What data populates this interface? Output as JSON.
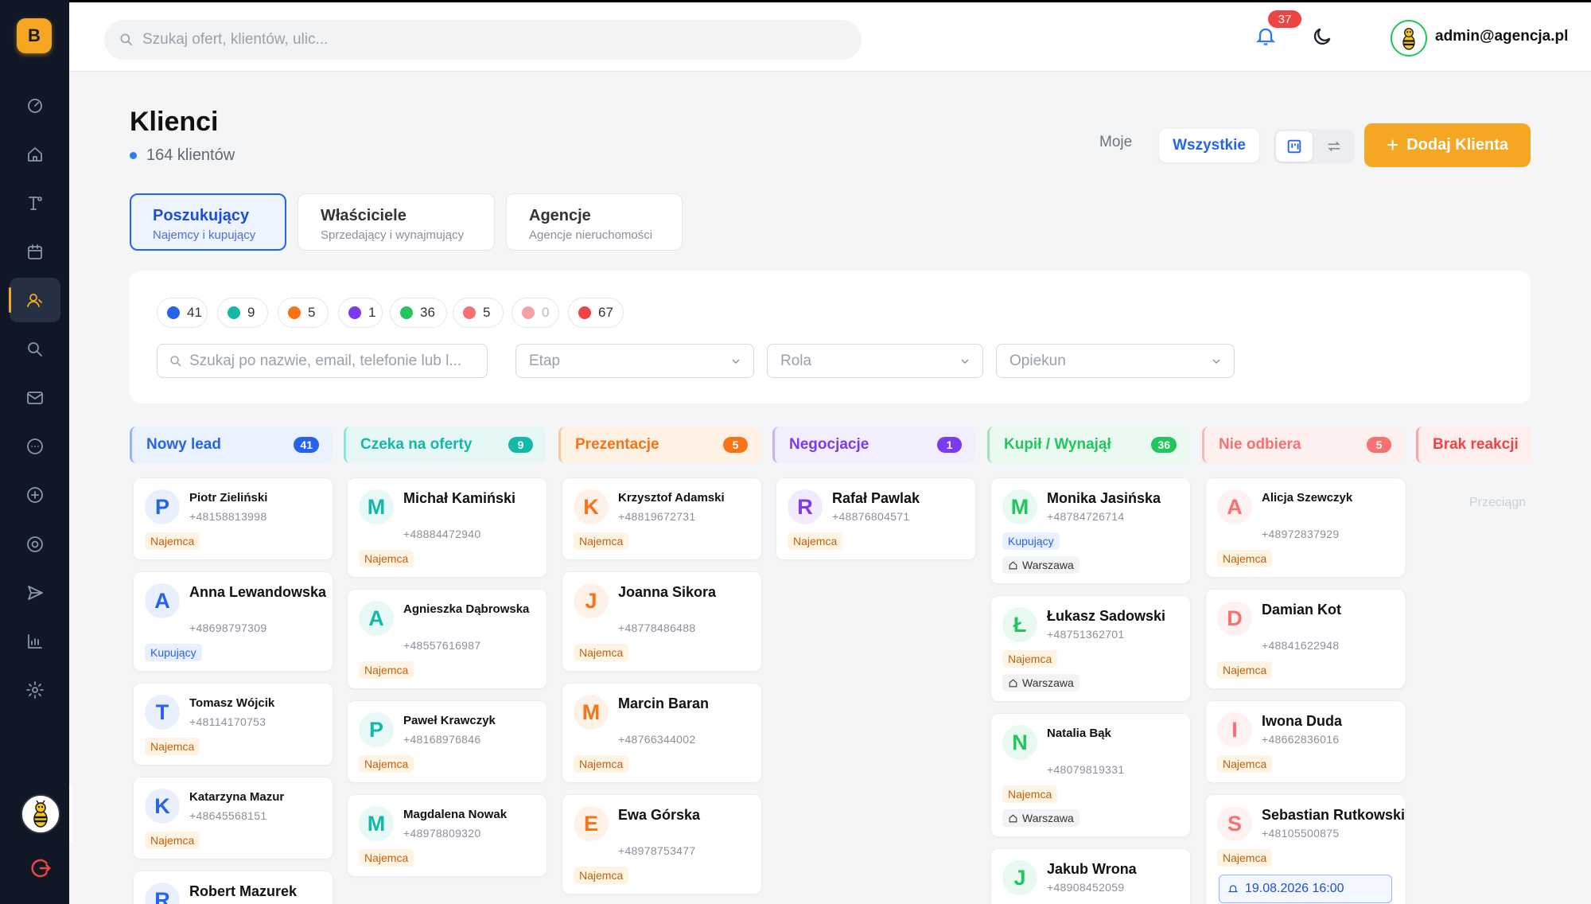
{
  "brand": {
    "logo_letter": "B"
  },
  "topbar": {
    "search_placeholder": "Szukaj ofert, klientów, ulic...",
    "notifications_count": "37",
    "user_email": "admin@agencja.pl"
  },
  "header": {
    "title": "Klienci",
    "count_text": "164 klientów",
    "toggle_mine": "Moje",
    "toggle_all": "Wszystkie",
    "add_button": "Dodaj Klienta"
  },
  "type_tabs": [
    {
      "title": "Poszukujący",
      "subtitle": "Najemcy i kupujący"
    },
    {
      "title": "Właściciele",
      "subtitle": "Sprzedający i wynajmujący"
    },
    {
      "title": "Agencje",
      "subtitle": "Agencje nieruchomości"
    }
  ],
  "stage_chips": [
    {
      "count": "41",
      "color": "#2563eb"
    },
    {
      "count": "9",
      "color": "#14b8a6"
    },
    {
      "count": "5",
      "color": "#f97316"
    },
    {
      "count": "1",
      "color": "#7c3aed"
    },
    {
      "count": "36",
      "color": "#22c55e"
    },
    {
      "count": "5",
      "color": "#f87171"
    },
    {
      "count": "0",
      "color": "#f3a0a6"
    },
    {
      "count": "67",
      "color": "#ef4444"
    }
  ],
  "filters": {
    "search_placeholder": "Szukaj po nazwie, email, telefonie lub l...",
    "stage_placeholder": "Etap",
    "role_placeholder": "Rola",
    "owner_placeholder": "Opiekun"
  },
  "columns": [
    {
      "title": "Nowy lead",
      "count": "41",
      "color": "#2563eb",
      "bg": "#eaf1ff",
      "border": "#93b4f5",
      "cards": [
        {
          "initial": "P",
          "name": "Piotr Zieliński",
          "phone": "+48158813998",
          "tags": [
            "Najemca"
          ]
        },
        {
          "initial": "A",
          "name": "Anna Lewandowska",
          "phone": "+48698797309",
          "tags": [
            "Kupujący"
          ]
        },
        {
          "initial": "T",
          "name": "Tomasz Wójcik",
          "phone": "+48114170753",
          "tags": [
            "Najemca"
          ]
        },
        {
          "initial": "K",
          "name": "Katarzyna Mazur",
          "phone": "+48645568151",
          "tags": [
            "Najemca"
          ]
        },
        {
          "initial": "R",
          "name": "Robert Mazurek",
          "phone": "",
          "tags": []
        }
      ]
    },
    {
      "title": "Czeka na oferty",
      "count": "9",
      "color": "#14b8a6",
      "bg": "#e6f8f6",
      "border": "#8fe3d9",
      "cards": [
        {
          "initial": "M",
          "name": "Michał Kamiński",
          "phone": "+48884472940",
          "tags": [
            "Najemca"
          ]
        },
        {
          "initial": "A",
          "name": "Agnieszka Dąbrowska",
          "phone": "+48557616987",
          "tags": [
            "Najemca"
          ]
        },
        {
          "initial": "P",
          "name": "Paweł Krawczyk",
          "phone": "+48168976846",
          "tags": [
            "Najemca"
          ]
        },
        {
          "initial": "M",
          "name": "Magdalena Nowak",
          "phone": "+48978809320",
          "tags": [
            "Najemca"
          ]
        }
      ]
    },
    {
      "title": "Prezentacje",
      "count": "5",
      "color": "#f97316",
      "bg": "#fff1e4",
      "border": "#fbc79a",
      "cards": [
        {
          "initial": "K",
          "name": "Krzysztof Adamski",
          "phone": "+48819672731",
          "tags": [
            "Najemca"
          ]
        },
        {
          "initial": "J",
          "name": "Joanna Sikora",
          "phone": "+48778486488",
          "tags": [
            "Najemca"
          ]
        },
        {
          "initial": "M",
          "name": "Marcin Baran",
          "phone": "+48766344002",
          "tags": [
            "Najemca"
          ]
        },
        {
          "initial": "E",
          "name": "Ewa Górska",
          "phone": "+48978753477",
          "tags": [
            "Najemca"
          ]
        }
      ]
    },
    {
      "title": "Negocjacje",
      "count": "1",
      "color": "#7c3aed",
      "bg": "#f3eefe",
      "border": "#c6b0f6",
      "cards": [
        {
          "initial": "R",
          "name": "Rafał Pawlak",
          "phone": "+48876804571",
          "tags": [
            "Najemca"
          ]
        }
      ]
    },
    {
      "title": "Kupił / Wynajął",
      "count": "36",
      "color": "#22c55e",
      "bg": "#eafaf0",
      "border": "#9ee4b6",
      "cards": [
        {
          "initial": "M",
          "name": "Monika Jasińska",
          "phone": "+48784726714",
          "tags": [
            "Kupujący"
          ],
          "location": "Warszawa"
        },
        {
          "initial": "Ł",
          "name": "Łukasz Sadowski",
          "phone": "+48751362701",
          "tags": [
            "Najemca"
          ],
          "location": "Warszawa"
        },
        {
          "initial": "N",
          "name": "Natalia Bąk",
          "phone": "+48079819331",
          "tags": [
            "Najemca"
          ],
          "location": "Warszawa"
        },
        {
          "initial": "J",
          "name": "Jakub Wrona",
          "phone": "+48908452059",
          "tags": []
        }
      ]
    },
    {
      "title": "Nie odbiera",
      "count": "5",
      "color": "#f87171",
      "bg": "#fff0f0",
      "border": "#f8b8b8",
      "cards": [
        {
          "initial": "A",
          "name": "Alicja Szewczyk",
          "phone": "+48972837929",
          "tags": [
            "Najemca"
          ]
        },
        {
          "initial": "D",
          "name": "Damian Kot",
          "phone": "+48841622948",
          "tags": [
            "Najemca"
          ]
        },
        {
          "initial": "I",
          "name": "Iwona Duda",
          "phone": "+48662836016",
          "tags": [
            "Najemca"
          ]
        },
        {
          "initial": "S",
          "name": "Sebastian Rutkowski",
          "phone": "+48105500875",
          "tags": [
            "Najemca"
          ],
          "event": "19.08.2026 16:00"
        }
      ]
    },
    {
      "title": "Brak reakcji",
      "count": "",
      "color": "#ef4444",
      "bg": "#ffeeee",
      "border": "#f5a5a5",
      "cards": []
    }
  ],
  "drag_hint": "Przeciągn"
}
